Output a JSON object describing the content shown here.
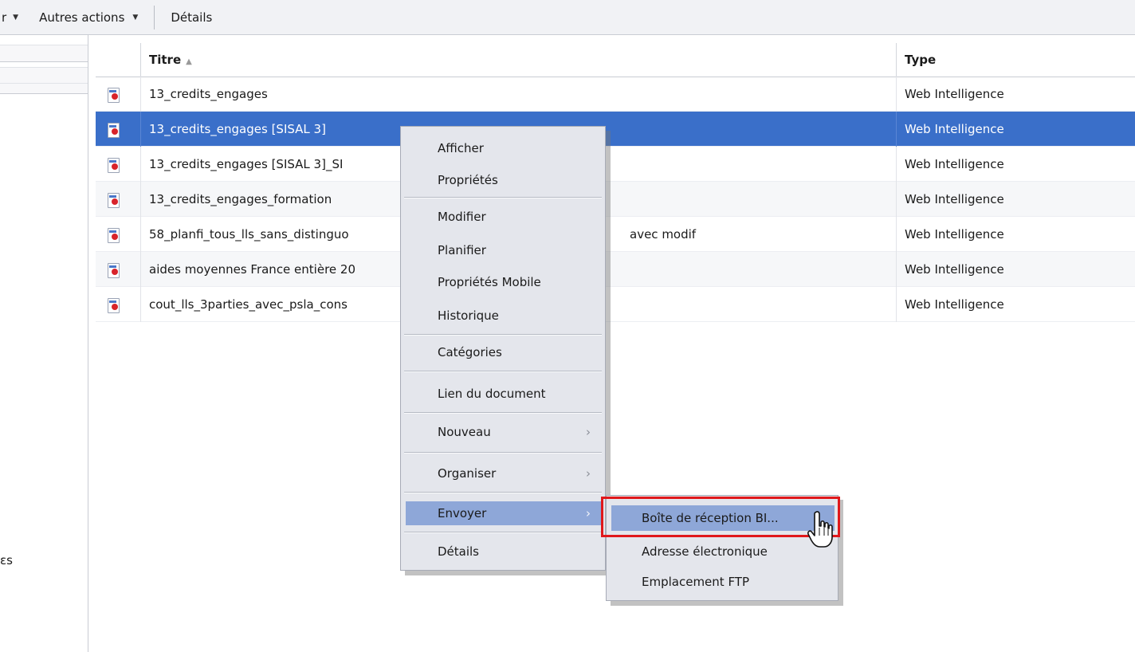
{
  "toolbar": {
    "partial_label": "r",
    "more_actions": "Autres actions",
    "details": "Détails"
  },
  "left_panel": {
    "partial_label": "ɛs"
  },
  "table": {
    "columns": {
      "title": "Titre",
      "type": "Type"
    },
    "rows": [
      {
        "title": "13_credits_engages",
        "type": "Web Intelligence",
        "extra": ""
      },
      {
        "title": "13_credits_engages [SISAL 3]",
        "type": "Web Intelligence",
        "extra": ""
      },
      {
        "title": "13_credits_engages [SISAL 3]_SI",
        "type": "Web Intelligence",
        "extra": ""
      },
      {
        "title": "13_credits_engages_formation",
        "type": "Web Intelligence",
        "extra": ""
      },
      {
        "title": "58_planfi_tous_lls_sans_distinguo",
        "type": "Web Intelligence",
        "extra": "avec modif"
      },
      {
        "title": "aides moyennes France entière 20",
        "type": "Web Intelligence",
        "extra": ""
      },
      {
        "title": "cout_lls_3parties_avec_psla_cons",
        "type": "Web Intelligence",
        "extra": ""
      }
    ]
  },
  "context_menu": {
    "afficher": "Afficher",
    "proprietes": "Propriétés",
    "modifier": "Modifier",
    "planifier": "Planifier",
    "proprietes_mobile": "Propriétés Mobile",
    "historique": "Historique",
    "categories": "Catégories",
    "lien_document": "Lien du document",
    "nouveau": "Nouveau",
    "organiser": "Organiser",
    "envoyer": "Envoyer",
    "details": "Détails"
  },
  "submenu": {
    "boite_reception": "Boîte de réception BI...",
    "adresse_electronique": "Adresse électronique",
    "emplacement_ftp": "Emplacement FTP"
  },
  "colors": {
    "selection": "#3a6fc9",
    "menu_hover": "#8ea7d8",
    "highlight": "#e0181b"
  }
}
